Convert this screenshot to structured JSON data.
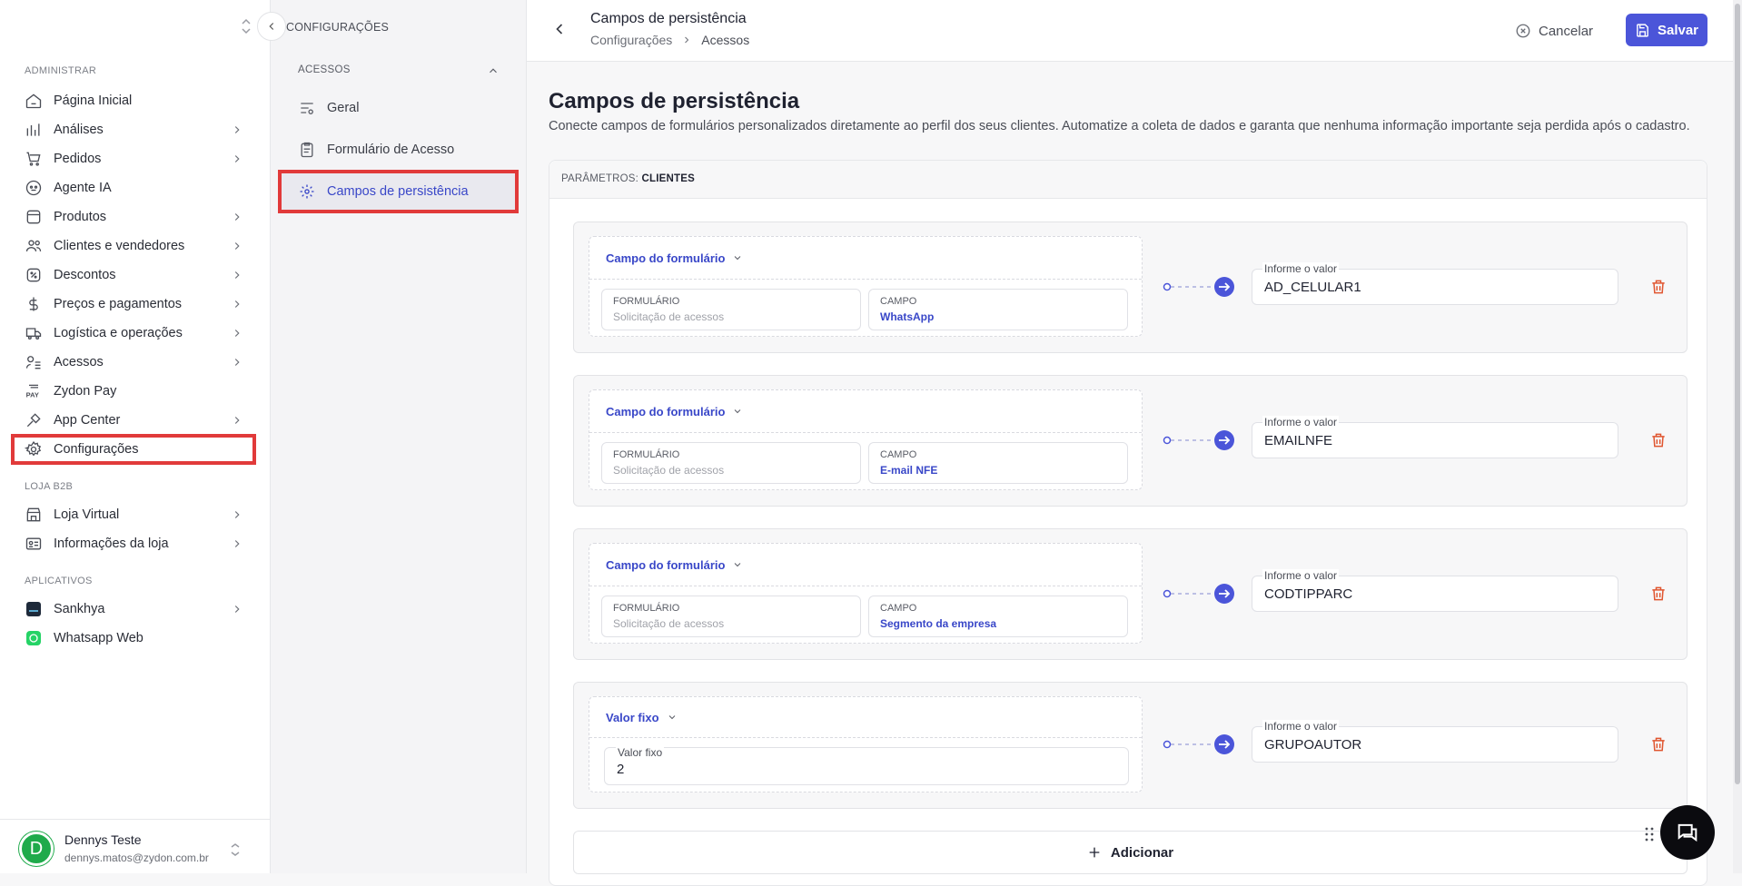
{
  "sidebar": {
    "sections": {
      "admin": "ADMINISTRAR",
      "store": "LOJA B2B",
      "apps": "APLICATIVOS"
    },
    "items": [
      {
        "label": "Página Inicial",
        "icon": "home-icon"
      },
      {
        "label": "Análises",
        "icon": "chart-bars-icon"
      },
      {
        "label": "Pedidos",
        "icon": "cart-icon"
      },
      {
        "label": "Agente IA",
        "icon": "robot-icon"
      },
      {
        "label": "Produtos",
        "icon": "box-icon"
      },
      {
        "label": "Clientes e vendedores",
        "icon": "users-icon"
      },
      {
        "label": "Descontos",
        "icon": "discount-icon"
      },
      {
        "label": "Preços e pagamentos",
        "icon": "dollar-icon"
      },
      {
        "label": "Logística e operações",
        "icon": "truck-icon"
      },
      {
        "label": "Acessos",
        "icon": "access-icon"
      },
      {
        "label": "Zydon Pay",
        "icon": "pay-icon"
      },
      {
        "label": "App Center",
        "icon": "plug-icon"
      },
      {
        "label": "Configurações",
        "icon": "gear-icon"
      }
    ],
    "store_items": [
      {
        "label": "Loja Virtual",
        "icon": "store-icon"
      },
      {
        "label": "Informações da loja",
        "icon": "id-card-icon"
      }
    ],
    "app_items": [
      {
        "label": "Sankhya",
        "icon": "sankhya-icon"
      },
      {
        "label": "Whatsapp Web",
        "icon": "whatsapp-icon"
      }
    ],
    "user": {
      "initial": "D",
      "name": "Dennys Teste",
      "email": "dennys.matos@zydon.com.br"
    }
  },
  "subnav": {
    "title": "CONFIGURAÇÕES",
    "section": "ACESSOS",
    "items": [
      {
        "label": "Geral",
        "icon": "sliders-icon"
      },
      {
        "label": "Formulário de Acesso",
        "icon": "clipboard-icon"
      },
      {
        "label": "Campos de persistência",
        "icon": "gear-cog-icon"
      }
    ]
  },
  "header": {
    "title": "Campos de persistência",
    "breadcrumb": [
      "Configurações",
      "Acessos"
    ],
    "cancel_label": "Cancelar",
    "save_label": "Salvar"
  },
  "main": {
    "title": "Campos de persistência",
    "description": "Conecte campos de formulários personalizados diretamente ao perfil dos seus clientes. Automatize a coleta de dados e garanta que nenhuma informação importante seja perdida após o cadastro.",
    "params_label": "PARÂMETROS:",
    "params_value": "CLIENTES",
    "rows": [
      {
        "source_type": "Campo do formulário",
        "form_label": "FORMULÁRIO",
        "form_value": "Solicitação de acessos",
        "field_label": "CAMPO",
        "field_value": "WhatsApp",
        "target_label": "Informe o valor",
        "target_value": "AD_CELULAR1"
      },
      {
        "source_type": "Campo do formulário",
        "form_label": "FORMULÁRIO",
        "form_value": "Solicitação de acessos",
        "field_label": "CAMPO",
        "field_value": "E-mail NFE",
        "target_label": "Informe o valor",
        "target_value": "EMAILNFE"
      },
      {
        "source_type": "Campo do formulário",
        "form_label": "FORMULÁRIO",
        "form_value": "Solicitação de acessos",
        "field_label": "CAMPO",
        "field_value": "Segmento da empresa",
        "target_label": "Informe o valor",
        "target_value": "CODTIPPARC"
      },
      {
        "source_type": "Valor fixo",
        "fixed_label": "Valor fixo",
        "fixed_value": "2",
        "target_label": "Informe o valor",
        "target_value": "GRUPOAUTOR"
      }
    ],
    "add_label": "Adicionar"
  },
  "colors": {
    "accent": "#4b55d9",
    "highlight": "#e13a3a",
    "delete": "#e0552f"
  }
}
